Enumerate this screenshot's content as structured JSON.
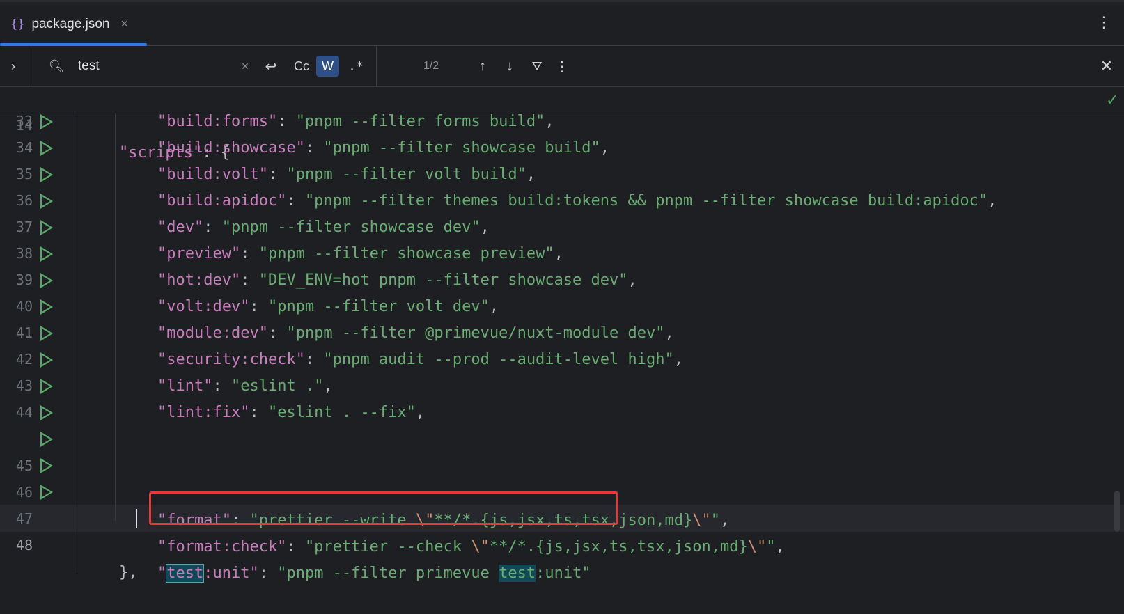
{
  "tab": {
    "icon": "{}",
    "label": "package.json",
    "close": "×"
  },
  "tab_menu_icon": "⋮",
  "find": {
    "query": "test",
    "placeholder": "",
    "case_label": "Cc",
    "word_label": "W",
    "regex_label": ".*",
    "match_count": "1/2"
  },
  "sticky": {
    "line": "14",
    "key": "\"scripts\"",
    "rest": ": {"
  },
  "lines": [
    {
      "n": "33",
      "k": "\"build:forms\"",
      "v": "\"pnpm --filter forms build\""
    },
    {
      "n": "34",
      "k": "\"build:showcase\"",
      "v": "\"pnpm --filter showcase build\""
    },
    {
      "n": "35",
      "k": "\"build:volt\"",
      "v": "\"pnpm --filter volt build\""
    },
    {
      "n": "36",
      "k": "\"build:apidoc\"",
      "v": "\"pnpm --filter themes build:tokens && pnpm --filter showcase build:apidoc\""
    },
    {
      "n": "37",
      "k": "\"dev\"",
      "v": "\"pnpm --filter showcase dev\""
    },
    {
      "n": "38",
      "k": "\"preview\"",
      "v": "\"pnpm --filter showcase preview\""
    },
    {
      "n": "39",
      "k": "\"hot:dev\"",
      "v": "\"DEV_ENV=hot pnpm --filter showcase dev\""
    },
    {
      "n": "40",
      "k": "\"volt:dev\"",
      "v": "\"pnpm --filter volt dev\""
    },
    {
      "n": "41",
      "k": "\"module:dev\"",
      "v": "\"pnpm --filter @primevue/nuxt-module dev\""
    },
    {
      "n": "42",
      "k": "\"security:check\"",
      "v": "\"pnpm audit --prod --audit-level high\""
    },
    {
      "n": "43",
      "k": "\"lint\"",
      "v": "\"eslint .\""
    },
    {
      "n": "44",
      "k": "\"lint:fix\"",
      "v": "\"eslint . --fix\""
    }
  ],
  "line45": {
    "n": "45",
    "k": "\"format\"",
    "v1": "\"prettier --write ",
    "esc1": "\\\"",
    "v2": "**/*.{js,jsx,ts,tsx,json,md}",
    "esc2": "\\\"",
    "v3": "\""
  },
  "line46": {
    "n": "46",
    "k": "\"format:check\"",
    "v1": "\"prettier --check ",
    "esc1": "\\\"",
    "v2": "**/*.{js,jsx,ts,tsx,json,md}",
    "esc2": "\\\"",
    "v3": "\""
  },
  "line47": {
    "n": "47",
    "q1": "\"",
    "m1": "test",
    "k_rest": ":unit\"",
    "sep": ": ",
    "v1": "\"pnpm --filter primevue ",
    "m2": "test",
    "v2": ":unit\""
  },
  "line48": {
    "n": "48",
    "text": "},"
  },
  "punct": {
    "colon": ": ",
    "comma": ","
  },
  "colors": {
    "accent": "#3574f0",
    "highlight_box": "#e53935",
    "match_bg": "#114957",
    "run_icon": "#59a869"
  }
}
